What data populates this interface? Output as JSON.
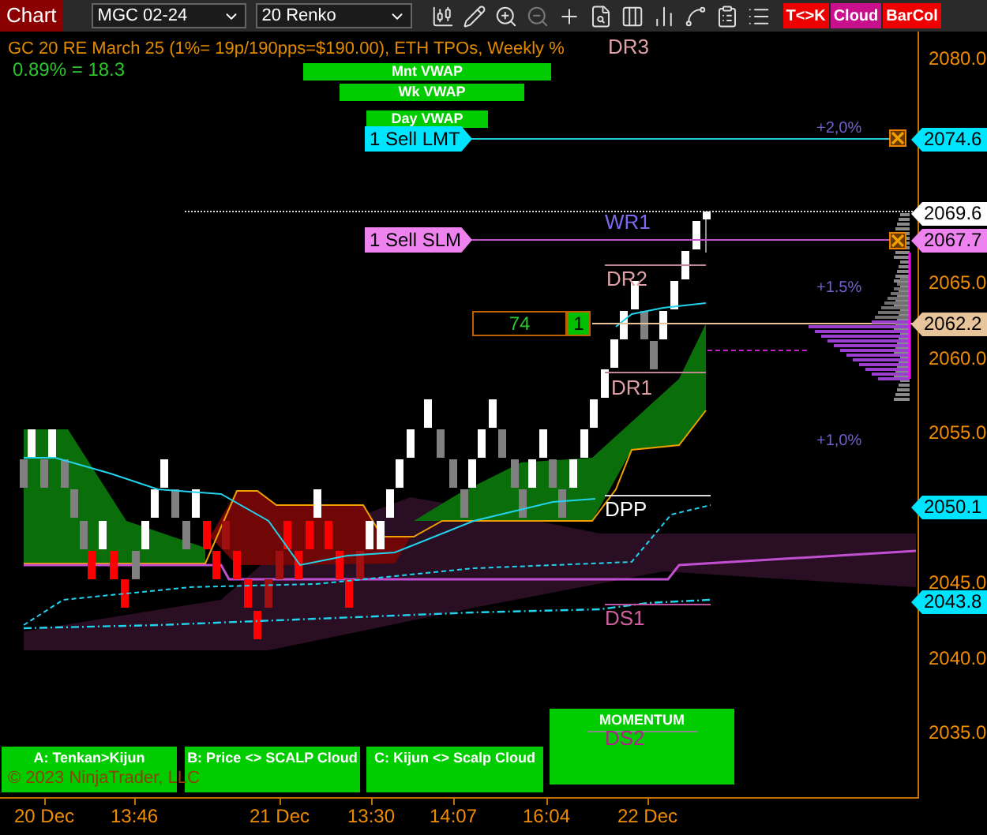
{
  "toolbar": {
    "title": "Chart",
    "instrument": "MGC 02-24",
    "bar_type": "20 Renko",
    "toggles": [
      {
        "label": "T<>K",
        "color": "#ee0000"
      },
      {
        "label": "Cloud",
        "color": "#c8108c"
      },
      {
        "label": "BarCol",
        "color": "#ee0000"
      }
    ]
  },
  "chart": {
    "title": "GC 20 RE March 25 (1%= 19p/190pps=$190.00), ETH TPOs, Weekly %",
    "percent_move": "0.89% = 18.3",
    "vwap_labels": [
      "Mnt VWAP",
      "Wk VWAP",
      "Day VWAP"
    ],
    "orders": [
      {
        "label": "1 Sell LMT",
        "color": "#00e5ff"
      },
      {
        "label": "1 Sell SLM",
        "color": "#ee82ee"
      }
    ],
    "position": {
      "quantity": "74",
      "count": "1"
    },
    "pivot_labels": [
      {
        "text": "DR3",
        "color": "#e0a0a8"
      },
      {
        "text": "WR1",
        "color": "#7b68ee"
      },
      {
        "text": "DR2",
        "color": "#e0a0a8"
      },
      {
        "text": "DR1",
        "color": "#e0a0a8"
      },
      {
        "text": "DPP",
        "color": "#ffffff"
      },
      {
        "text": "DS1",
        "color": "#d060a0"
      },
      {
        "text": "DS2",
        "color": "#b0208a"
      }
    ],
    "percent_labels": [
      "+2,0%",
      "+1.5%",
      "+1,0%"
    ],
    "signal_panels": [
      "A: Tenkan>Kijun",
      "B: Price <> SCALP Cloud",
      "C: Kijun <> Scalp Cloud"
    ],
    "momentum_panel": "MOMENTUM",
    "copyright": "© 2023 NinjaTrader, LLC"
  },
  "price_axis": {
    "ticks": [
      "2080.0",
      "2065.0",
      "2060.0",
      "2055.0",
      "2045.0",
      "2040.0",
      "2035.0"
    ],
    "flags": [
      {
        "text": "2074.6",
        "color": "#00e5ff"
      },
      {
        "text": "2069.6",
        "color": "#ffffff"
      },
      {
        "text": "2067.7",
        "color": "#ee82ee"
      },
      {
        "text": "2062.2",
        "color": "#e8c49a"
      },
      {
        "text": "2050.1",
        "color": "#00e5ff"
      },
      {
        "text": "2043.8",
        "color": "#00e5ff"
      }
    ]
  },
  "time_axis": {
    "labels": [
      "20 Dec",
      "13:46",
      "21 Dec",
      "13:30",
      "14:07",
      "16:04",
      "22 Dec"
    ]
  }
}
